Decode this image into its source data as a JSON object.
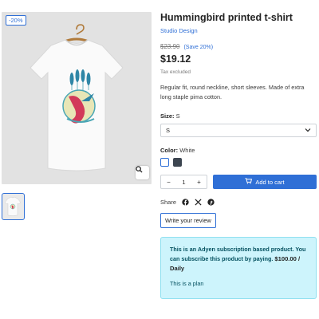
{
  "gallery": {
    "discount_badge": "-20%",
    "zoom_icon": "search-icon"
  },
  "product": {
    "title": "Hummingbird printed t-shirt",
    "brand": "Studio Design",
    "old_price": "$23.90",
    "save": "(Save 20%)",
    "price": "$19.12",
    "tax": "Tax excluded",
    "description": "Regular fit, round neckline, short sleeves. Made of extra long staple pima cotton."
  },
  "size": {
    "label": "Size:",
    "value": "S",
    "selected_option": "S"
  },
  "color": {
    "label": "Color:",
    "value": "White",
    "swatches": [
      "#ffffff",
      "#3c4550"
    ]
  },
  "cart": {
    "minus": "−",
    "quantity": "1",
    "plus": "+",
    "add_label": "Add to cart"
  },
  "share": {
    "label": "Share",
    "icons": [
      "facebook-icon",
      "x-icon",
      "pinterest-icon"
    ]
  },
  "review": {
    "button_label": "Write your review"
  },
  "subscription": {
    "text": "This is an Adyen subscription based product. You can subscribe this product by paying.",
    "price": "$100.00 / Daily",
    "plan": "This is a plan"
  },
  "colors": {
    "accent": "#2f6fd6",
    "info_bg": "#cdf4fc"
  }
}
